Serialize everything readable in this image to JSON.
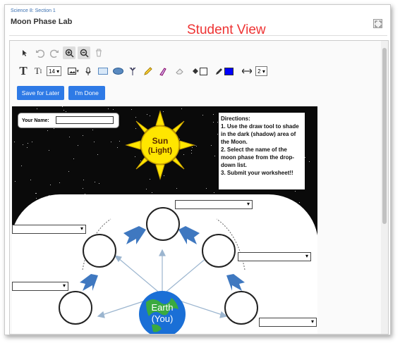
{
  "breadcrumb": "Science 8: Section 1",
  "lab_title": "Moon Phase Lab",
  "overlay_label": "Student View",
  "toolbar": {
    "font_size": "14",
    "line_width": "2",
    "fill_color": "#0000ff",
    "icons": [
      "pointer-icon",
      "undo-icon",
      "redo-icon",
      "zoom-in-icon",
      "zoom-out-icon",
      "trash-icon",
      "text-icon",
      "text-size-icon",
      "image-icon",
      "microphone-icon",
      "rectangle-icon",
      "ellipse-icon",
      "stamp-icon",
      "pencil-icon",
      "highlighter-icon",
      "eraser-icon",
      "fill-icon",
      "pen-color-icon",
      "line-width-icon"
    ]
  },
  "buttons": {
    "save_later": "Save for Later",
    "done": "I'm Done"
  },
  "worksheet": {
    "name_label": "Your Name:",
    "sun_label_1": "Sun",
    "sun_label_2": "(Light)",
    "directions": "Directions:\n1. Use the draw tool to shade in the dark (shadow) area of the Moon.\n2. Select the name of the moon phase from the drop-down list.\n3. Submit your worksheet!!",
    "earth_label_1": "Earth",
    "earth_label_2": "(You)",
    "colors": {
      "sun": "#ffe600",
      "arrow": "#3f78c0",
      "earth": "#1a6fd6"
    }
  }
}
